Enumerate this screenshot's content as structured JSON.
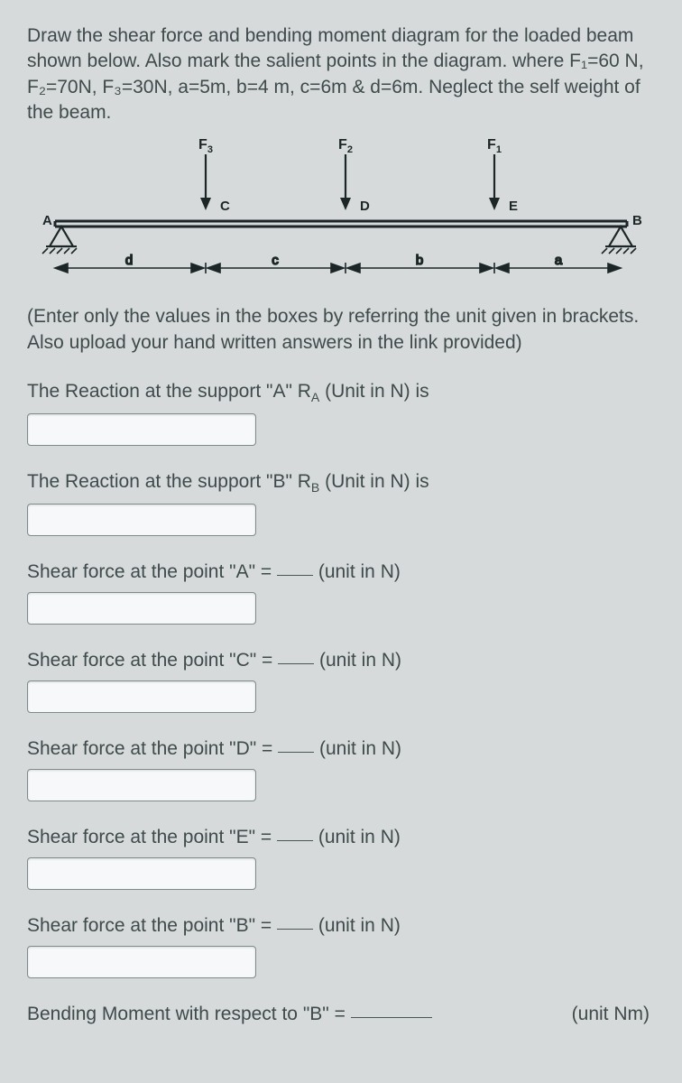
{
  "prompt": {
    "line1": "Draw the shear force and bending moment diagram for the loaded beam shown below.  Also mark the salient points in the diagram. where F₁=60 N, F₂=70N, F₃=30N, a=5m, b=4 m, c=6m & d=6m. Neglect the self weight of the beam."
  },
  "figure": {
    "forces": [
      "F3",
      "F2",
      "F1"
    ],
    "force_sub": [
      "3",
      "2",
      "1"
    ],
    "top_points": [
      "C",
      "D",
      "E"
    ],
    "end_labels": [
      "A",
      "B"
    ],
    "spans": [
      "d",
      "c",
      "b",
      "a"
    ]
  },
  "instructions": "(Enter only the values in the boxes by referring the unit given in brackets.  Also upload your hand written answers in the link provided)",
  "questions": {
    "ra_label_pre": "The Reaction at the support \"A\"  R",
    "ra_sub": "A",
    "ra_label_post": "  (Unit in N) is",
    "rb_label_pre": "The Reaction at the support \"B\"  R",
    "rb_sub": "B",
    "rb_label_post": "  (Unit in N) is",
    "sf_a": "Shear force at the point \"A\" = ",
    "sf_c": "Shear force at the point \"C\" = ",
    "sf_d": "Shear force at the point \"D\" = ",
    "sf_e": "Shear force at the point \"E\" = ",
    "sf_b": "Shear force at the point \"B\" = ",
    "unit_n": " (unit in N)",
    "bm_b_pre": "Bending Moment with respect to \"B\" = ",
    "unit_nm": " (unit Nm)"
  }
}
